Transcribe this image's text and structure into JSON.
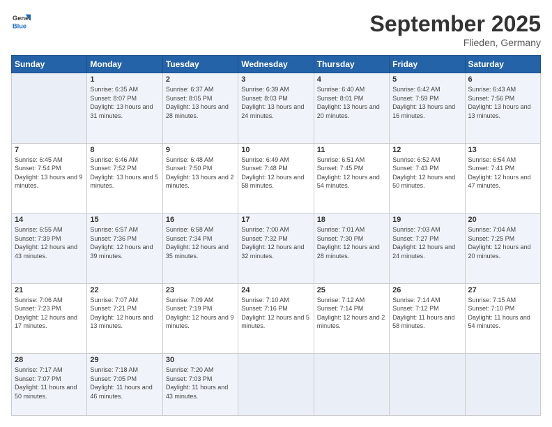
{
  "logo": {
    "general": "General",
    "blue": "Blue"
  },
  "title": "September 2025",
  "subtitle": "Flieden, Germany",
  "days": [
    "Sunday",
    "Monday",
    "Tuesday",
    "Wednesday",
    "Thursday",
    "Friday",
    "Saturday"
  ],
  "weeks": [
    [
      {
        "day": "",
        "sunrise": "",
        "sunset": "",
        "daylight": ""
      },
      {
        "day": "1",
        "sunrise": "Sunrise: 6:35 AM",
        "sunset": "Sunset: 8:07 PM",
        "daylight": "Daylight: 13 hours and 31 minutes."
      },
      {
        "day": "2",
        "sunrise": "Sunrise: 6:37 AM",
        "sunset": "Sunset: 8:05 PM",
        "daylight": "Daylight: 13 hours and 28 minutes."
      },
      {
        "day": "3",
        "sunrise": "Sunrise: 6:39 AM",
        "sunset": "Sunset: 8:03 PM",
        "daylight": "Daylight: 13 hours and 24 minutes."
      },
      {
        "day": "4",
        "sunrise": "Sunrise: 6:40 AM",
        "sunset": "Sunset: 8:01 PM",
        "daylight": "Daylight: 13 hours and 20 minutes."
      },
      {
        "day": "5",
        "sunrise": "Sunrise: 6:42 AM",
        "sunset": "Sunset: 7:59 PM",
        "daylight": "Daylight: 13 hours and 16 minutes."
      },
      {
        "day": "6",
        "sunrise": "Sunrise: 6:43 AM",
        "sunset": "Sunset: 7:56 PM",
        "daylight": "Daylight: 13 hours and 13 minutes."
      }
    ],
    [
      {
        "day": "7",
        "sunrise": "Sunrise: 6:45 AM",
        "sunset": "Sunset: 7:54 PM",
        "daylight": "Daylight: 13 hours and 9 minutes."
      },
      {
        "day": "8",
        "sunrise": "Sunrise: 6:46 AM",
        "sunset": "Sunset: 7:52 PM",
        "daylight": "Daylight: 13 hours and 5 minutes."
      },
      {
        "day": "9",
        "sunrise": "Sunrise: 6:48 AM",
        "sunset": "Sunset: 7:50 PM",
        "daylight": "Daylight: 13 hours and 2 minutes."
      },
      {
        "day": "10",
        "sunrise": "Sunrise: 6:49 AM",
        "sunset": "Sunset: 7:48 PM",
        "daylight": "Daylight: 12 hours and 58 minutes."
      },
      {
        "day": "11",
        "sunrise": "Sunrise: 6:51 AM",
        "sunset": "Sunset: 7:45 PM",
        "daylight": "Daylight: 12 hours and 54 minutes."
      },
      {
        "day": "12",
        "sunrise": "Sunrise: 6:52 AM",
        "sunset": "Sunset: 7:43 PM",
        "daylight": "Daylight: 12 hours and 50 minutes."
      },
      {
        "day": "13",
        "sunrise": "Sunrise: 6:54 AM",
        "sunset": "Sunset: 7:41 PM",
        "daylight": "Daylight: 12 hours and 47 minutes."
      }
    ],
    [
      {
        "day": "14",
        "sunrise": "Sunrise: 6:55 AM",
        "sunset": "Sunset: 7:39 PM",
        "daylight": "Daylight: 12 hours and 43 minutes."
      },
      {
        "day": "15",
        "sunrise": "Sunrise: 6:57 AM",
        "sunset": "Sunset: 7:36 PM",
        "daylight": "Daylight: 12 hours and 39 minutes."
      },
      {
        "day": "16",
        "sunrise": "Sunrise: 6:58 AM",
        "sunset": "Sunset: 7:34 PM",
        "daylight": "Daylight: 12 hours and 35 minutes."
      },
      {
        "day": "17",
        "sunrise": "Sunrise: 7:00 AM",
        "sunset": "Sunset: 7:32 PM",
        "daylight": "Daylight: 12 hours and 32 minutes."
      },
      {
        "day": "18",
        "sunrise": "Sunrise: 7:01 AM",
        "sunset": "Sunset: 7:30 PM",
        "daylight": "Daylight: 12 hours and 28 minutes."
      },
      {
        "day": "19",
        "sunrise": "Sunrise: 7:03 AM",
        "sunset": "Sunset: 7:27 PM",
        "daylight": "Daylight: 12 hours and 24 minutes."
      },
      {
        "day": "20",
        "sunrise": "Sunrise: 7:04 AM",
        "sunset": "Sunset: 7:25 PM",
        "daylight": "Daylight: 12 hours and 20 minutes."
      }
    ],
    [
      {
        "day": "21",
        "sunrise": "Sunrise: 7:06 AM",
        "sunset": "Sunset: 7:23 PM",
        "daylight": "Daylight: 12 hours and 17 minutes."
      },
      {
        "day": "22",
        "sunrise": "Sunrise: 7:07 AM",
        "sunset": "Sunset: 7:21 PM",
        "daylight": "Daylight: 12 hours and 13 minutes."
      },
      {
        "day": "23",
        "sunrise": "Sunrise: 7:09 AM",
        "sunset": "Sunset: 7:19 PM",
        "daylight": "Daylight: 12 hours and 9 minutes."
      },
      {
        "day": "24",
        "sunrise": "Sunrise: 7:10 AM",
        "sunset": "Sunset: 7:16 PM",
        "daylight": "Daylight: 12 hours and 5 minutes."
      },
      {
        "day": "25",
        "sunrise": "Sunrise: 7:12 AM",
        "sunset": "Sunset: 7:14 PM",
        "daylight": "Daylight: 12 hours and 2 minutes."
      },
      {
        "day": "26",
        "sunrise": "Sunrise: 7:14 AM",
        "sunset": "Sunset: 7:12 PM",
        "daylight": "Daylight: 11 hours and 58 minutes."
      },
      {
        "day": "27",
        "sunrise": "Sunrise: 7:15 AM",
        "sunset": "Sunset: 7:10 PM",
        "daylight": "Daylight: 11 hours and 54 minutes."
      }
    ],
    [
      {
        "day": "28",
        "sunrise": "Sunrise: 7:17 AM",
        "sunset": "Sunset: 7:07 PM",
        "daylight": "Daylight: 11 hours and 50 minutes."
      },
      {
        "day": "29",
        "sunrise": "Sunrise: 7:18 AM",
        "sunset": "Sunset: 7:05 PM",
        "daylight": "Daylight: 11 hours and 46 minutes."
      },
      {
        "day": "30",
        "sunrise": "Sunrise: 7:20 AM",
        "sunset": "Sunset: 7:03 PM",
        "daylight": "Daylight: 11 hours and 43 minutes."
      },
      {
        "day": "",
        "sunrise": "",
        "sunset": "",
        "daylight": ""
      },
      {
        "day": "",
        "sunrise": "",
        "sunset": "",
        "daylight": ""
      },
      {
        "day": "",
        "sunrise": "",
        "sunset": "",
        "daylight": ""
      },
      {
        "day": "",
        "sunrise": "",
        "sunset": "",
        "daylight": ""
      }
    ]
  ]
}
